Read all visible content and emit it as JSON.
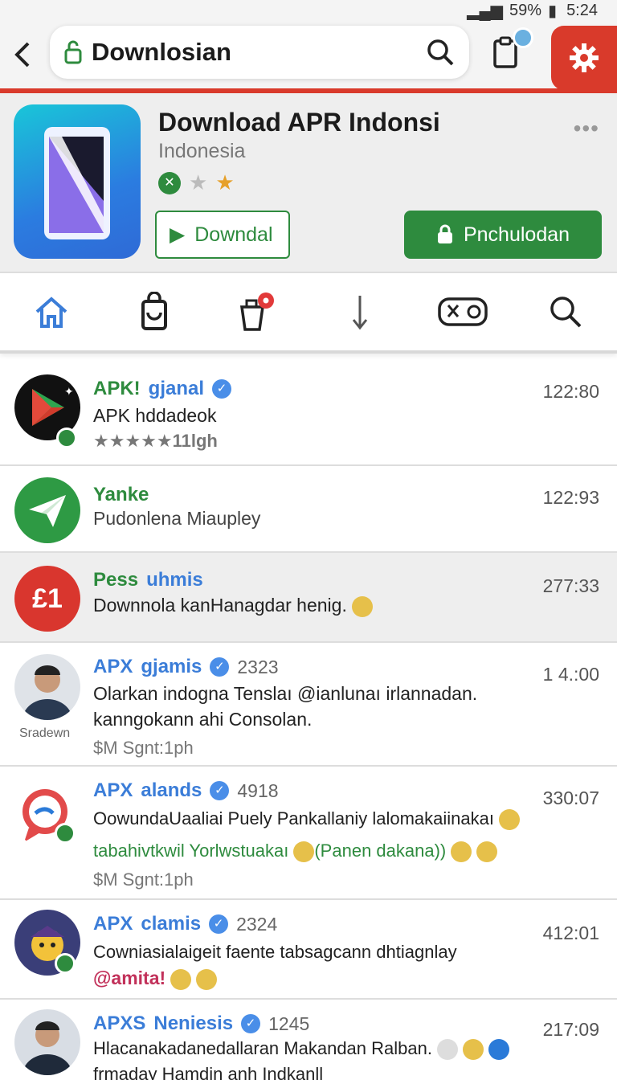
{
  "status": {
    "battery": "59%",
    "time": "5:24"
  },
  "topbar": {
    "title": "Downlosian"
  },
  "app": {
    "title": "Download APR Indonsi",
    "subtitle": "Indonesia",
    "more": "•••",
    "btn_download": "Downdal",
    "btn_install": "Pnchulodan"
  },
  "nav": [
    "home",
    "bag",
    "cart",
    "download",
    "game",
    "search"
  ],
  "rows": [
    {
      "name": "APK!",
      "tag": "gjanal",
      "text": "APK hddadeok",
      "meta": "★★★★★11lgh",
      "time": "122:80"
    },
    {
      "name": "Yanke",
      "text": "Pudonlena Miaupley",
      "time": "122:93"
    },
    {
      "name": "Pess",
      "tag": "uhmis",
      "text": "Downnola kanHanagdar henig.",
      "time": "277:33"
    },
    {
      "name": "APX",
      "tag": "gjamis",
      "count": "2323",
      "text": "Olarkan indogna Tenslaı",
      "text2": "@ianlunaı irlannadan.",
      "text3": "kanngokann ahi Consolan.",
      "meta": "$M Sgnt:1ph",
      "avatar_label": "Sradewn",
      "time": "1 4.:00"
    },
    {
      "name": "APX",
      "tag": "alands",
      "count": "4918",
      "text": "OowundaUaaliai Puely Pankallaniy lalomakaiinakaı",
      "text2": "tabahivtkwil Yorlwstuakaı",
      "text3": "(Panen dakana))",
      "meta": "$M Sgnt:1ph",
      "time": "330:07"
    },
    {
      "name": "APX",
      "tag": "clamis",
      "count": "2324",
      "text": "Cowniasialaigeit faente",
      "text2": "tabsagcann dhtiagnlay",
      "text3": "@amita!",
      "time": "412:01"
    },
    {
      "name": "APXS",
      "tag": "Neniesis",
      "count": "1245",
      "text": "Hlacanakadanedallaran Makandan Ralban.",
      "text2": "frmaday Hamdin anh Indkanll",
      "time": "217:09"
    }
  ]
}
